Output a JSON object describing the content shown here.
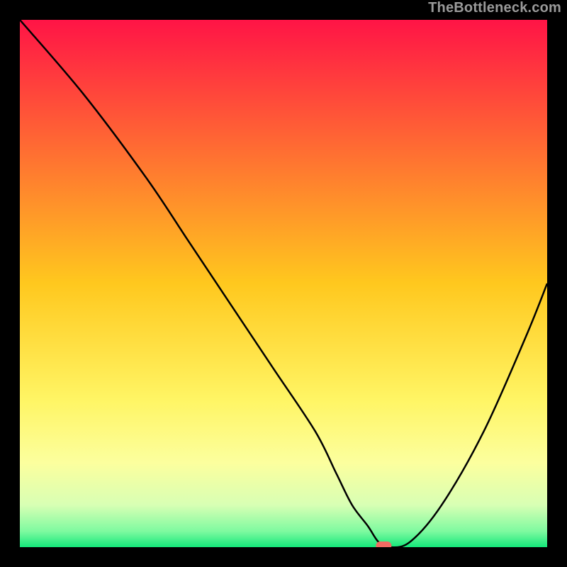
{
  "watermark": "TheBottleneck.com",
  "chart_data": {
    "type": "line",
    "title": "",
    "xlabel": "",
    "ylabel": "",
    "xlim": [
      0,
      100
    ],
    "ylim": [
      0,
      100
    ],
    "x": [
      0,
      12,
      24,
      32,
      40,
      48,
      56,
      60,
      63,
      66,
      68,
      70,
      74,
      80,
      88,
      96,
      100
    ],
    "values": [
      100,
      86,
      70,
      58,
      46,
      34,
      22,
      14,
      8,
      4,
      1,
      0,
      1,
      8,
      22,
      40,
      50
    ],
    "marker": {
      "x": 69,
      "y": 0
    },
    "gradient_stops": [
      {
        "offset": 0.0,
        "color": "#ff1446"
      },
      {
        "offset": 0.25,
        "color": "#ff6e32"
      },
      {
        "offset": 0.5,
        "color": "#ffc81e"
      },
      {
        "offset": 0.72,
        "color": "#fff564"
      },
      {
        "offset": 0.84,
        "color": "#fcff9e"
      },
      {
        "offset": 0.92,
        "color": "#d8ffb4"
      },
      {
        "offset": 0.97,
        "color": "#7efaa0"
      },
      {
        "offset": 1.0,
        "color": "#14e87a"
      }
    ],
    "marker_color": "#f16a62",
    "curve_color": "#000000"
  }
}
